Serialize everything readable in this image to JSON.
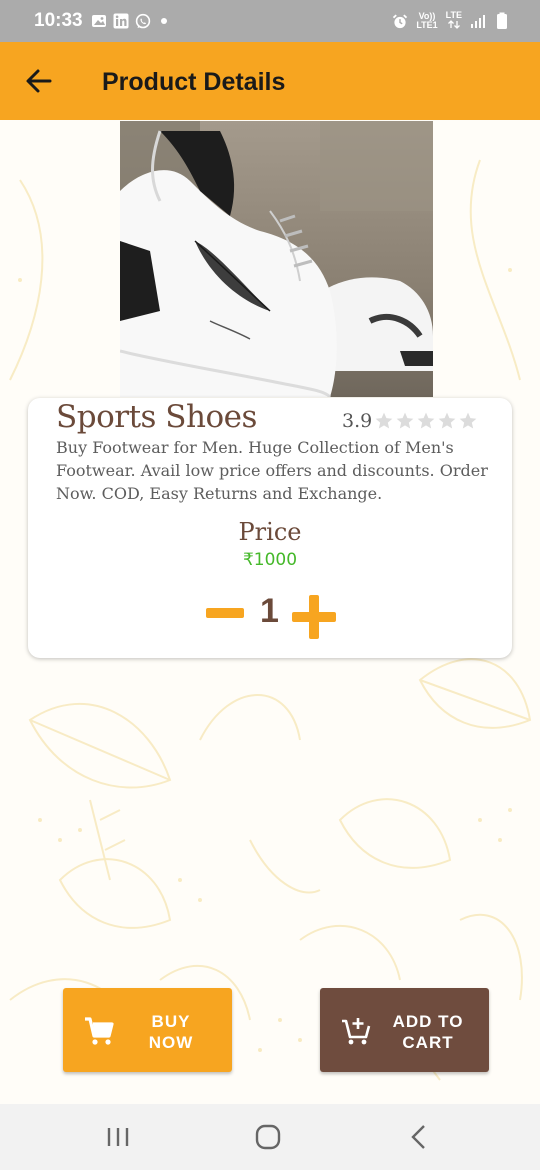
{
  "status_bar": {
    "time": "10:33",
    "left_icons": [
      "gallery-icon",
      "linkedin-icon",
      "whatsapp-icon"
    ],
    "volte_label": "Vo))",
    "lte_label": "LTE",
    "lte1_label": "LTE1"
  },
  "app_bar": {
    "title": "Product Details",
    "back_icon": "arrow-left-icon"
  },
  "product": {
    "name": "Sports Shoes",
    "rating": "3.9",
    "rating_value": 3.9,
    "stars_total": 5,
    "description": "Buy Footwear for Men. Huge Collection of Men's Footwear. Avail low price offers and discounts. Order Now. COD, Easy Returns and Exchange.",
    "price_label": "Price",
    "price": "₹1000",
    "quantity": "1"
  },
  "actions": {
    "buy_now_line1": "BUY",
    "buy_now_line2": "NOW",
    "add_to_cart_line1": "ADD TO",
    "add_to_cart_line2": "CART"
  },
  "colors": {
    "accent": "#f7a520",
    "brown": "#6f4c3e",
    "price_green": "#45b82a"
  }
}
